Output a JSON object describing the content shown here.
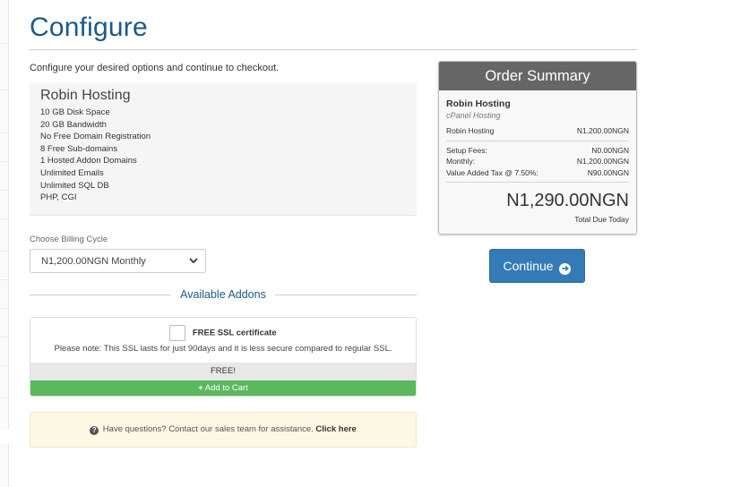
{
  "page": {
    "title": "Configure",
    "intro": "Configure your desired options and continue to checkout."
  },
  "product": {
    "name": "Robin Hosting",
    "features": [
      "10 GB Disk Space",
      "20 GB Bandwidth",
      "No Free Domain Registration",
      "8 Free Sub-domains",
      "1 Hosted Addon Domains",
      "Unlimited Emails",
      "Unlimited SQL DB",
      "PHP, CGI"
    ]
  },
  "billing": {
    "label": "Choose Billing Cycle",
    "selected": "N1,200.00NGN Monthly"
  },
  "addons": {
    "heading": "Available Addons",
    "items": [
      {
        "name": "FREE SSL certificate",
        "note": "Please note: This SSL lasts for just 90days and it is less secure compared to regular SSL.",
        "price": "FREE!",
        "button": "Add to Cart",
        "checked": false
      }
    ]
  },
  "help": {
    "text": "Have questions? Contact our sales team for assistance.",
    "link": "Click here"
  },
  "summary": {
    "heading": "Order Summary",
    "product_name": "Robin Hosting",
    "product_group": "cPanel Hosting",
    "line_item": {
      "label": "Robin Hosting",
      "value": "N1,200.00NGN"
    },
    "fees": [
      {
        "label": "Setup Fees:",
        "value": "N0.00NGN"
      },
      {
        "label": "Monthly:",
        "value": "N1,200.00NGN"
      },
      {
        "label": "Value Added Tax @ 7.50%:",
        "value": "N90.00NGN"
      }
    ],
    "total": "N1,290.00NGN",
    "total_label": "Total Due Today"
  },
  "actions": {
    "continue": "Continue"
  },
  "colors": {
    "title": "#1a5a8a",
    "primary_button": "#337ab7",
    "cart_button": "#5cb85c",
    "summary_header": "#666666",
    "help_background": "#fcf8e3"
  }
}
